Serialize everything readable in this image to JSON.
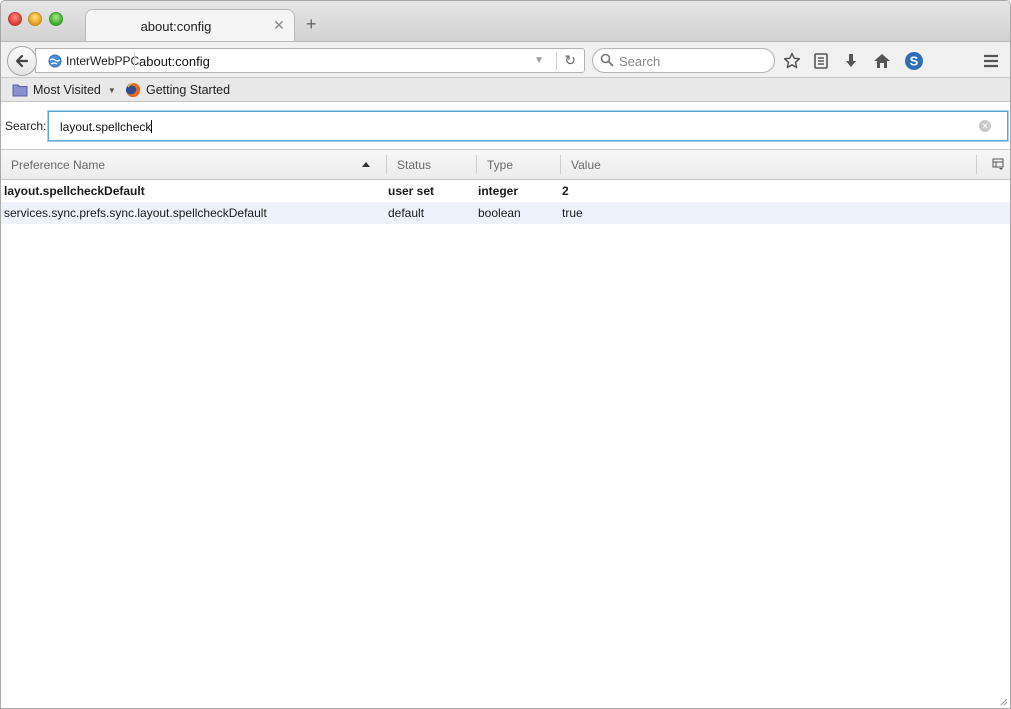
{
  "tab": {
    "title": "about:config"
  },
  "urlbar": {
    "identity_label": "InterWebPPC",
    "url": "about:config"
  },
  "search": {
    "placeholder": "Search"
  },
  "bookmarks": [
    {
      "label": "Most Visited",
      "icon": "folder-icon"
    },
    {
      "label": "Getting Started",
      "icon": "firefox-icon"
    }
  ],
  "filter": {
    "label": "Search:",
    "value": "layout.spellcheck"
  },
  "columns": {
    "name": "Preference Name",
    "status": "Status",
    "type": "Type",
    "value": "Value"
  },
  "rows": [
    {
      "name": "layout.spellcheckDefault",
      "status": "user set",
      "type": "integer",
      "value": "2"
    },
    {
      "name": "services.sync.prefs.sync.layout.spellcheckDefault",
      "status": "default",
      "type": "boolean",
      "value": "true"
    }
  ],
  "colors": {
    "accent_focus": "#5aa6d6",
    "row_alt": "#edf2fb"
  }
}
